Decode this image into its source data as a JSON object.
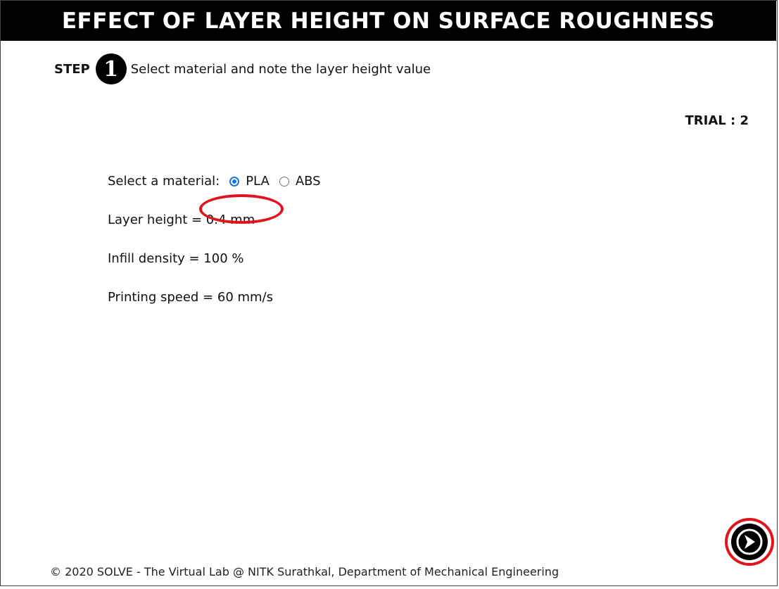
{
  "header": {
    "title": "EFFECT OF LAYER HEIGHT ON SURFACE ROUGHNESS"
  },
  "step": {
    "label": "STEP",
    "number": "1",
    "instruction": "Select material and note the layer height value"
  },
  "trial": {
    "label": "TRIAL : ",
    "value": "2"
  },
  "form": {
    "material_label": "Select a material:",
    "options": [
      {
        "label": "PLA",
        "selected": true
      },
      {
        "label": "ABS",
        "selected": false
      }
    ],
    "layer_height": "Layer height = 0.4 mm",
    "infill_density": "Infill density = 100 %",
    "printing_speed": "Printing speed = 60 mm/s"
  },
  "next": {
    "icon": "arrow-right-circle-icon"
  },
  "footer": {
    "text": "© 2020 SOLVE - The Virtual Lab @ NITK Surathkal, Department of Mechanical Engineering"
  },
  "colors": {
    "title_bg": "#000000",
    "highlight": "#e0141e",
    "radio_accent": "#1a73e8"
  }
}
